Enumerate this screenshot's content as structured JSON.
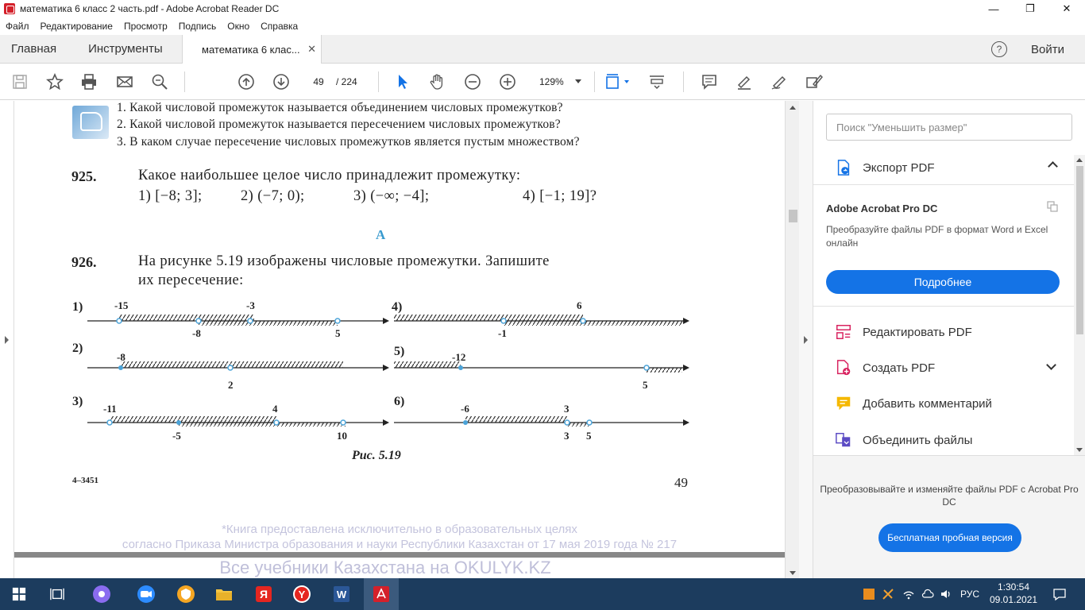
{
  "window": {
    "title": "математика 6 класс 2 часть.pdf - Adobe Acrobat Reader DC"
  },
  "menu": [
    "Файл",
    "Редактирование",
    "Просмотр",
    "Подпись",
    "Окно",
    "Справка"
  ],
  "tabs": {
    "home": "Главная",
    "tools": "Инструменты",
    "doc": "математика 6 клас...",
    "login": "Войти"
  },
  "toolbar": {
    "page_current": "49",
    "page_total": "/ 224",
    "zoom": "129%"
  },
  "document": {
    "questions": [
      "1. Какой числовой промежуток называется объединением числовых промежутков?",
      "2. Какой числовой промежуток называется пересечением числовых промежутков?",
      "3. В каком случае пересечение числовых промежутков является пустым множеством?"
    ],
    "p925": {
      "num": "925.",
      "text": "Какое наибольшее целое число принадлежит промежутку:",
      "options": [
        "1) [−8; 3];",
        "2) (−7; 0);",
        "3) (−∞; −4];",
        "4) [−1; 19]?"
      ]
    },
    "section": "А",
    "p926": {
      "num": "926.",
      "line1": "На рисунке 5.19 изображены числовые промежутки. Запишите",
      "line2": "их пересечение:"
    },
    "figures": [
      {
        "label": "1)",
        "top_labels": [
          "-15",
          "-3"
        ],
        "bottom_labels": [
          "-8",
          "5"
        ]
      },
      {
        "label": "2)",
        "top_labels": [
          "-8"
        ],
        "bottom_labels": [
          "2"
        ]
      },
      {
        "label": "3)",
        "top_labels": [
          "-11",
          "4"
        ],
        "bottom_labels": [
          "-5",
          "10"
        ]
      },
      {
        "label": "4)",
        "top_labels": [
          "6"
        ],
        "bottom_labels": [
          "-1"
        ]
      },
      {
        "label": "5)",
        "top_labels": [
          "-12"
        ],
        "bottom_labels": [
          "5"
        ]
      },
      {
        "label": "6)",
        "top_labels": [
          "-6",
          "3"
        ],
        "bottom_labels": [
          "3",
          "5"
        ]
      }
    ],
    "caption": "Рис. 5.19",
    "footer_code": "4–3451",
    "page_number": "49",
    "watermark": [
      "*Книга предоставлена исключительно в образовательных целях",
      "согласно Приказа Министра образования и науки Республики Казахстан от 17 мая 2019 года № 217",
      "Все учебники Казахстана на OKULYK.KZ"
    ]
  },
  "right_panel": {
    "search_placeholder": "Поиск \"Уменьшить размер\"",
    "export_title": "Экспорт PDF",
    "product": "Adobe Acrobat Pro DC",
    "description": "Преобразуйте файлы PDF в формат Word и Excel онлайн",
    "more_button": "Подробнее",
    "tools": [
      "Редактировать PDF",
      "Создать PDF",
      "Добавить комментарий",
      "Объединить файлы"
    ],
    "bottom_text": "Преобразовывайте и изменяйте файлы PDF с Acrobat Pro DC",
    "trial_button": "Бесплатная пробная версия"
  },
  "taskbar": {
    "lang": "РУС",
    "time": "1:30:54",
    "date": "09.01.2021"
  }
}
